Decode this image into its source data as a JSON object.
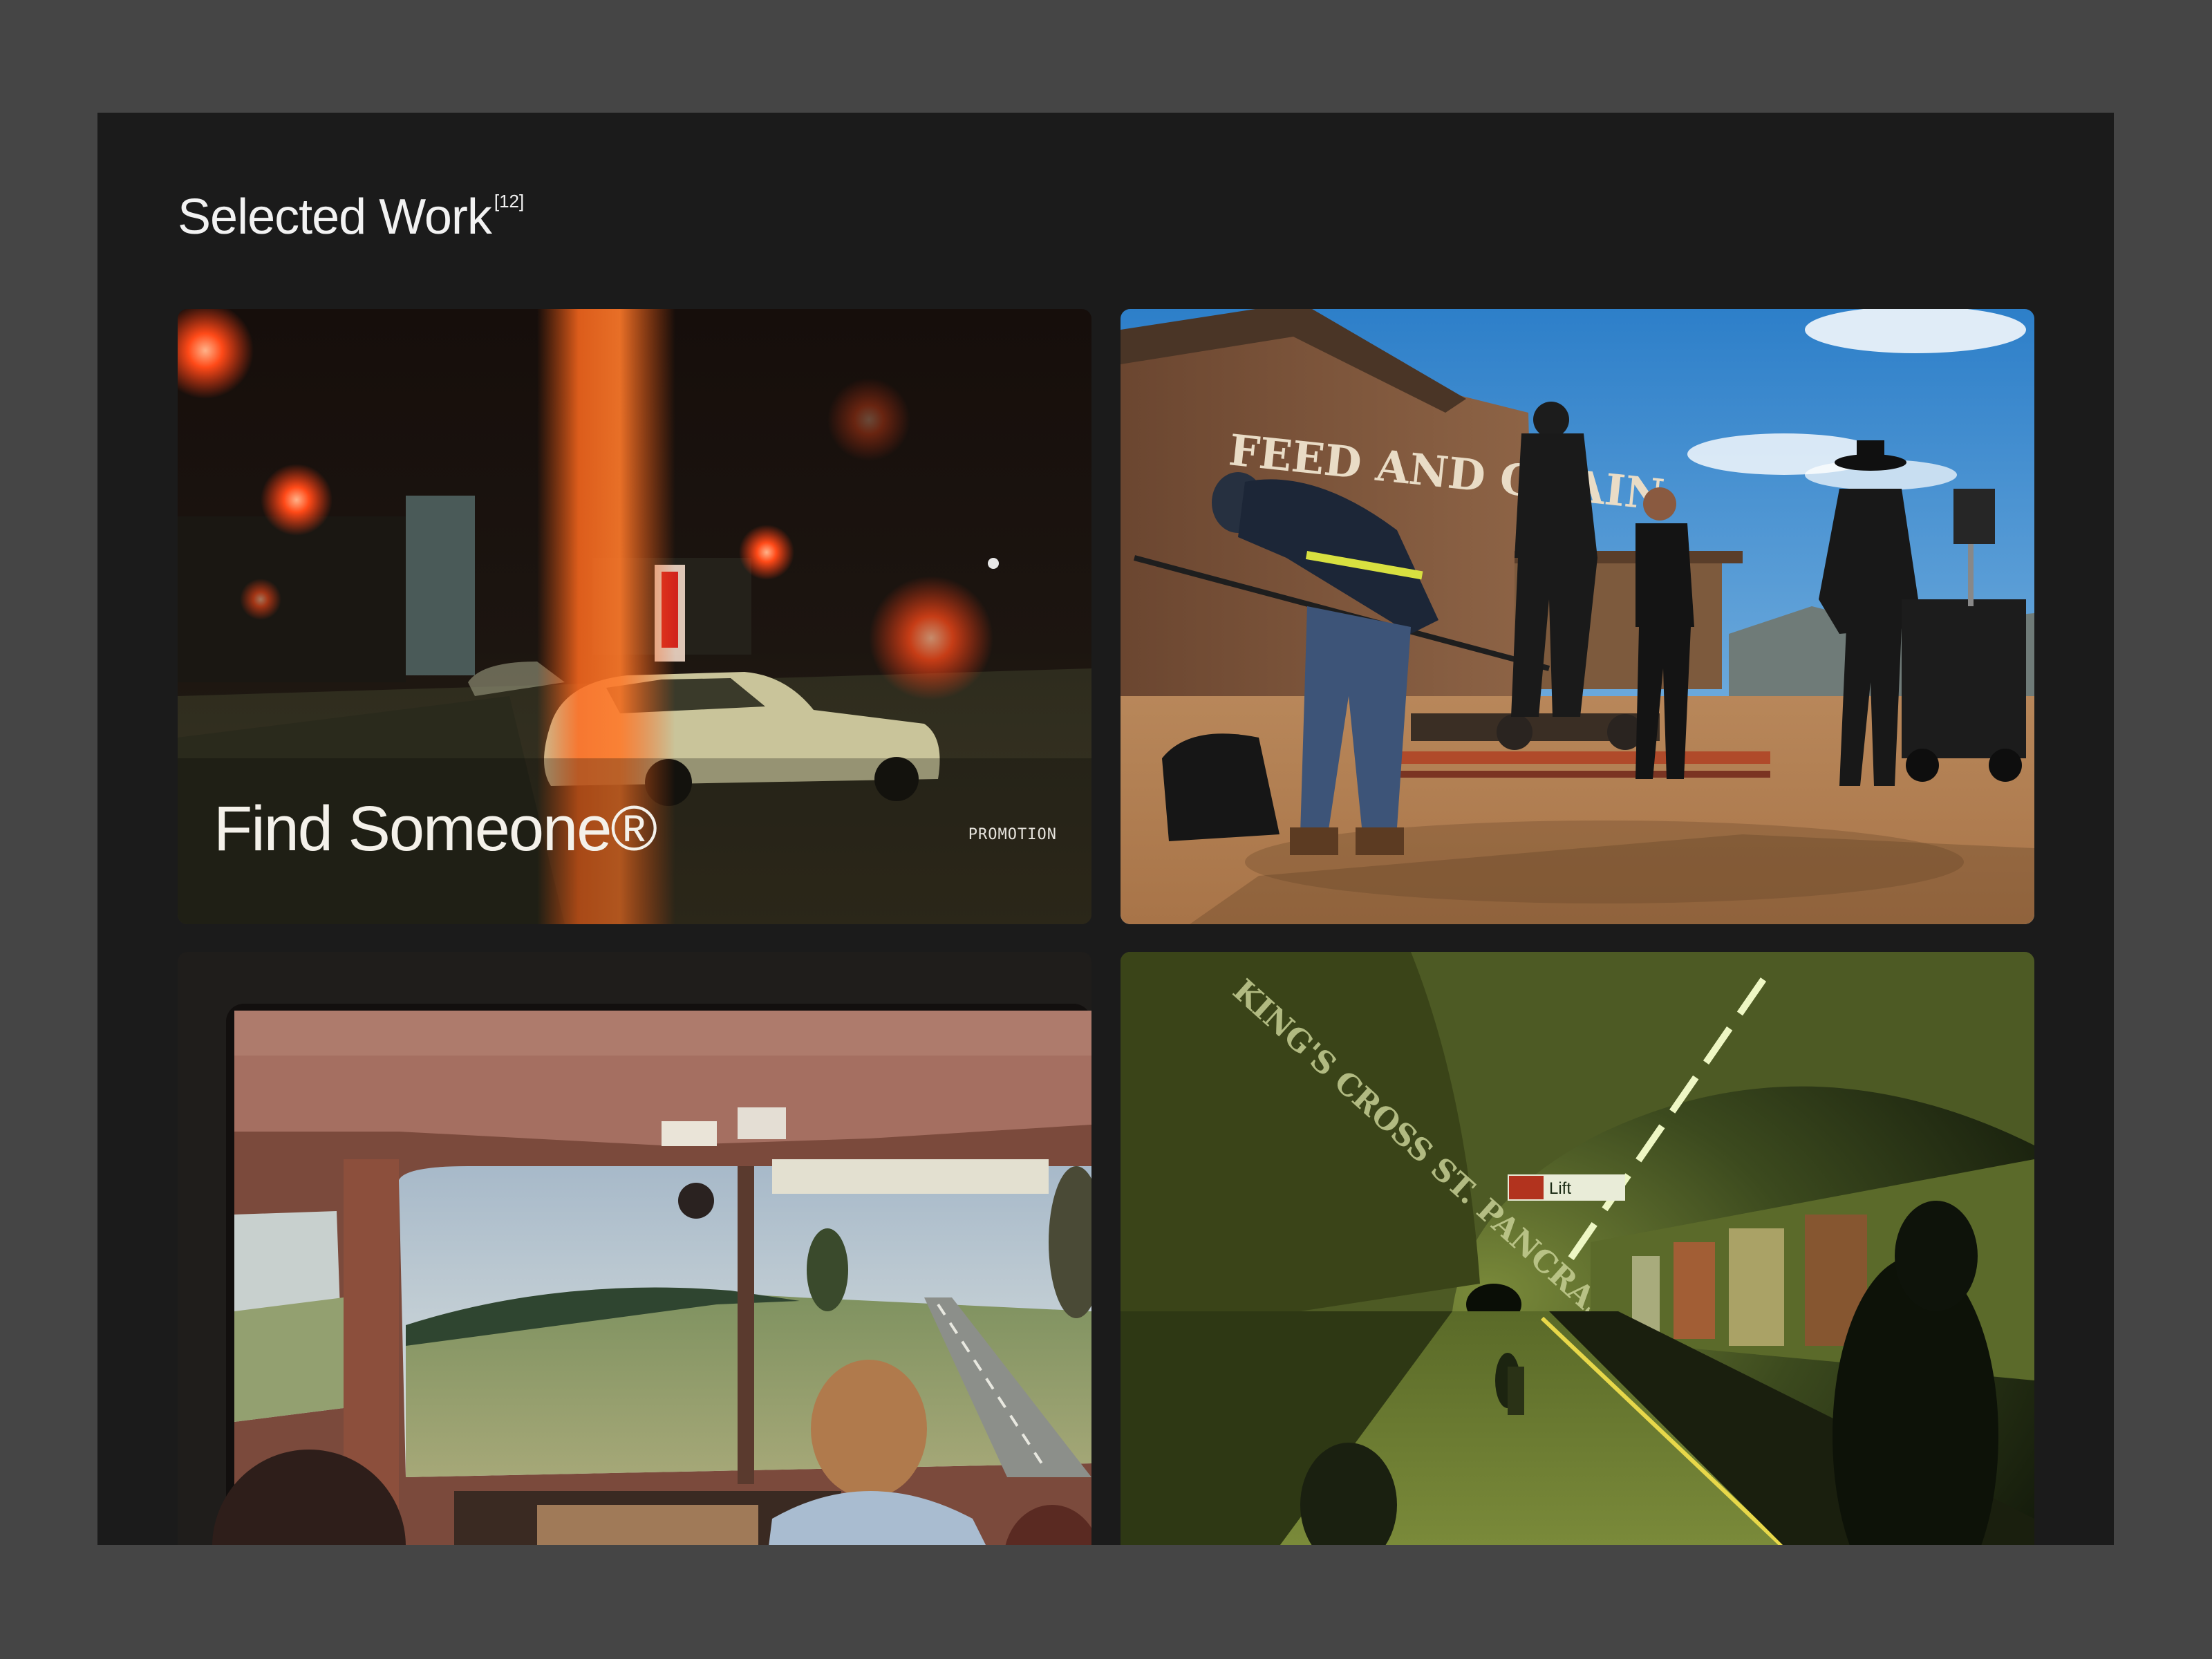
{
  "section": {
    "title": "Selected Work",
    "count": "[12]"
  },
  "works": [
    {
      "title": "Find Someone®",
      "tag": "PROMOTION",
      "photo": "night-street-parked-car"
    },
    {
      "title": "",
      "tag": "",
      "photo": "film-crew-western-set",
      "sign_text": "FEED AND GRAIN"
    },
    {
      "title": "",
      "tag": "",
      "photo": "bus-window-country-road"
    },
    {
      "title": "",
      "tag": "",
      "photo": "underground-station-platform",
      "sign_text": "KING'S CROSS ST. PANCRAS",
      "lift_sign": "Lift"
    }
  ],
  "colors": {
    "page_bg": "#454545",
    "panel_bg": "#1b1b1b",
    "text": "#f2f2f2"
  }
}
